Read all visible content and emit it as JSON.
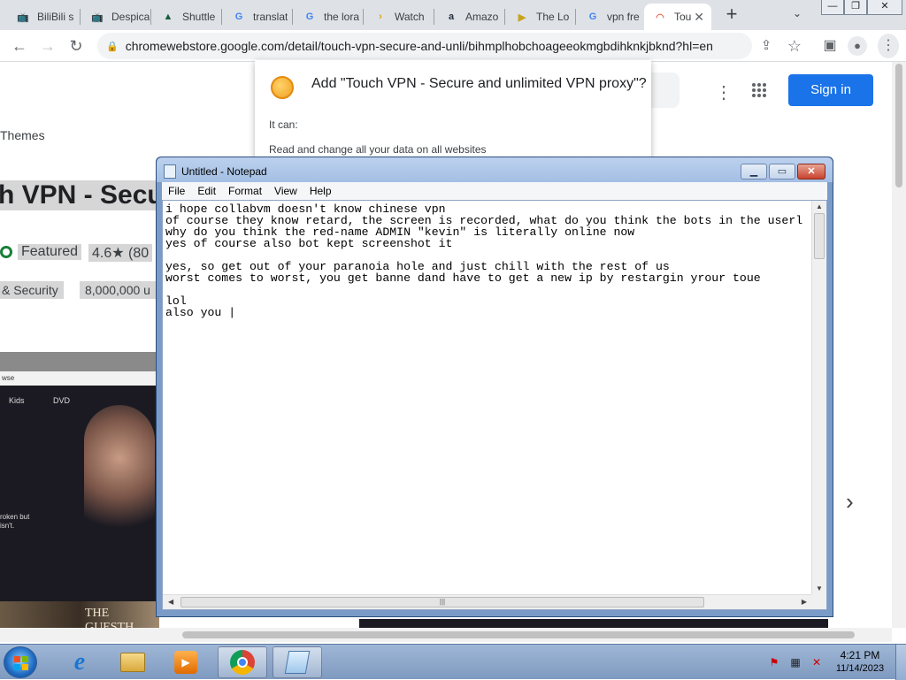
{
  "browser": {
    "tabs": [
      {
        "label": "BiliBili s",
        "icon": "bilibili-icon",
        "color": "#00a1d6"
      },
      {
        "label": "Despica",
        "icon": "bilibili-icon",
        "color": "#00a1d6"
      },
      {
        "label": "Shuttle",
        "icon": "shuttle-icon",
        "color": "#1a5c3a"
      },
      {
        "label": "translat",
        "icon": "google-icon",
        "color": "#4285f4"
      },
      {
        "label": "the lora",
        "icon": "google-icon",
        "color": "#4285f4"
      },
      {
        "label": "Watch",
        "icon": "plex-icon",
        "color": "#e5a00d"
      },
      {
        "label": "Amazo",
        "icon": "amazon-icon",
        "color": "#232f3e"
      },
      {
        "label": "The Lo",
        "icon": "film-icon",
        "color": "#c8a21a"
      },
      {
        "label": "vpn fre",
        "icon": "google-icon",
        "color": "#4285f4"
      },
      {
        "label": "Tou",
        "icon": "rainbow-icon",
        "color": "#e66a4f"
      }
    ],
    "new_tab_symbol": "+",
    "tab_search_symbol": "⌄",
    "window_controls": {
      "minimize": "—",
      "maximize": "❐",
      "close": "✕"
    },
    "url": "chromewebstore.google.com/detail/touch-vpn-secure-and-unli/bihmplhobchoageeokmgbdihknkjbknd?hl=en",
    "toolbar_icons": [
      "back-arrow-icon",
      "forward-arrow-icon",
      "reload-icon",
      "share-icon",
      "star-icon",
      "side-panel-icon",
      "profile-icon",
      "kebab-menu-icon"
    ]
  },
  "page": {
    "themes_link": "Themes",
    "title_fragment": "h VPN - Secu",
    "featured": "Featured",
    "rating": "4.6★ (80",
    "category": "& Security",
    "users": "8,000,000 u",
    "sign_in": "Sign in",
    "screenshot_nav": [
      "Kids",
      "DVD"
    ],
    "screenshot_small_text": "roken but\nisn't.",
    "screenshot_browse": "wse",
    "screenshot_banner": "THE GUESTH",
    "carousel_next": "›"
  },
  "ext_dialog": {
    "title": "Add \"Touch VPN - Secure and unlimited VPN proxy\"?",
    "it_can": "It can:",
    "permission": "Read and change all your data on all websites"
  },
  "notepad": {
    "title": "Untitled - Notepad",
    "menu": [
      "File",
      "Edit",
      "Format",
      "View",
      "Help"
    ],
    "text": "i hope collabvm doesn't know chinese vpn\nof course they know retard, the screen is recorded, what do you think the bots in the userl\nwhy do you think the red-name ADMIN \"kevin\" is literally online now\nyes of course also bot kept screenshot it\n\nyes, so get out of your paranoia hole and just chill with the rest of us\nworst comes to worst, you get banne dand have to get a new ip by restargin yrour toue\n\nlol\nalso you |"
  },
  "taskbar": {
    "apps": [
      "start-button",
      "internet-explorer-icon",
      "windows-explorer-icon",
      "media-player-icon",
      "chrome-icon",
      "notepad-icon"
    ],
    "time": "4:21 PM",
    "date": "11/14/2023"
  },
  "colors": {
    "chrome_tabstrip": "#dee1e6",
    "sign_in_blue": "#1a73e8",
    "taskbar_top": "#9fb7d6",
    "notepad_frame": "#7a9bc7"
  }
}
